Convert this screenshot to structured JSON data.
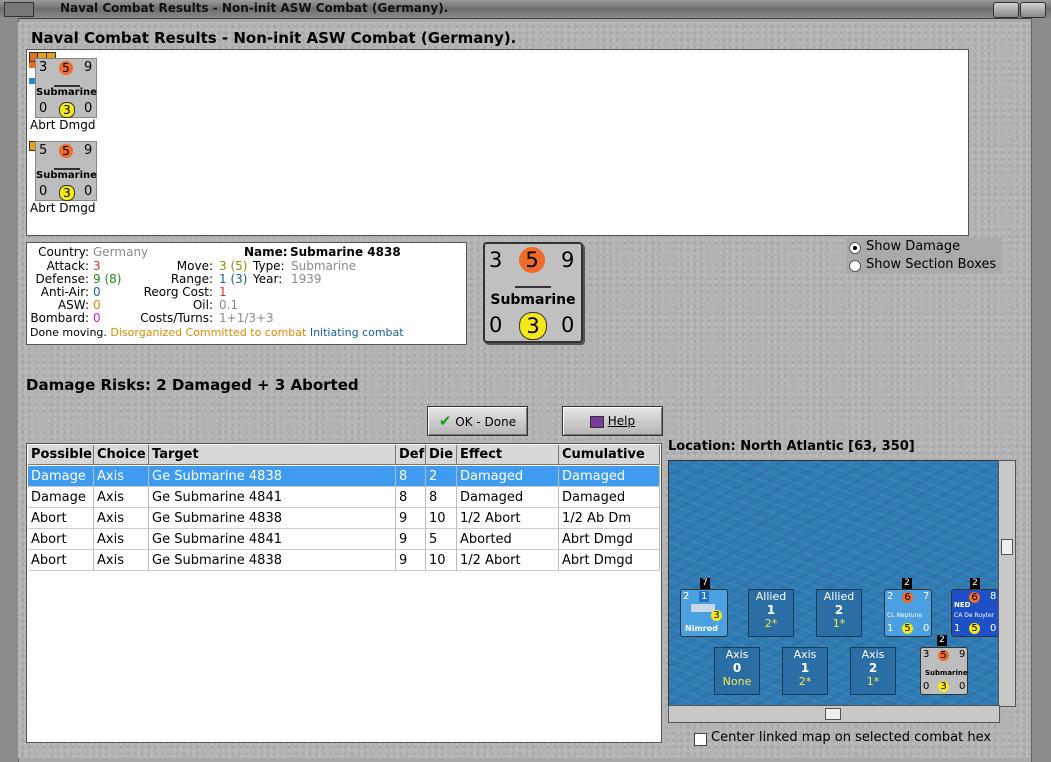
{
  "window": {
    "title": "Naval Combat Results - Non-init ASW Combat (Germany)."
  },
  "heading": "Naval Combat Results - Non-init ASW Combat (Germany).",
  "units": [
    {
      "top_left": "3",
      "top_mid": "5",
      "top_right": "9",
      "name": "Submarine",
      "bot_left": "0",
      "bot_mid": "3",
      "bot_right": "0",
      "caption": "Abrt Dmgd"
    },
    {
      "top_left": "5",
      "top_mid": "5",
      "top_right": "9",
      "name": "Submarine",
      "bot_left": "0",
      "bot_mid": "3",
      "bot_right": "0",
      "caption": "Abrt Dmgd"
    }
  ],
  "info": {
    "country_label": "Country:",
    "country": "Germany",
    "attack_label": "Attack:",
    "attack": "3",
    "defense_label": "Defense:",
    "defense": "9 (8)",
    "antiair_label": "Anti-Air:",
    "antiair": "0",
    "asw_label": "ASW:",
    "asw": "0",
    "bombard_label": "Bombard:",
    "bombard": "0",
    "move_label": "Move:",
    "move": "3 (5)",
    "range_label": "Range:",
    "range": "1 (3)",
    "reorg_label": "Reorg Cost:",
    "reorg": "1",
    "oil_label": "Oil:",
    "oil": "0.1",
    "costs_label": "Costs/Turns:",
    "costs": "1+1/3+3",
    "name_label": "Name:",
    "name": "Submarine 4838",
    "type_label": "Type:",
    "type": "Submarine",
    "year_label": "Year:",
    "year": "1939",
    "status_done": "Done moving.",
    "status_disorg": "Disorganized",
    "status_committed": "Committed to combat",
    "status_init": "Initiating combat"
  },
  "big_counter": {
    "top_left": "3",
    "top_mid": "5",
    "top_right": "9",
    "name": "Submarine",
    "bot_left": "0",
    "bot_mid": "3",
    "bot_right": "0"
  },
  "options": {
    "show_damage": "Show Damage",
    "show_sections": "Show Section Boxes"
  },
  "damage_risks": "Damage Risks:  2 Damaged + 3 Aborted",
  "buttons": {
    "ok": "OK - Done",
    "help": "Help"
  },
  "table": {
    "headers": [
      "Possible",
      "Choice",
      "Target",
      "Def",
      "Die",
      "Effect",
      "Cumulative"
    ],
    "rows": [
      [
        "Damage",
        "Axis",
        "Ge Submarine 4838",
        "8",
        "2",
        "Damaged",
        "Damaged"
      ],
      [
        "Damage",
        "Axis",
        "Ge Submarine 4841",
        "8",
        "8",
        "Damaged",
        "Damaged"
      ],
      [
        "Abort",
        "Axis",
        "Ge Submarine 4838",
        "9",
        "10",
        "1/2 Abort",
        "1/2 Ab Dm"
      ],
      [
        "Abort",
        "Axis",
        "Ge Submarine 4841",
        "9",
        "5",
        "Aborted",
        "Abrt Dmgd"
      ],
      [
        "Abort",
        "Axis",
        "Ge Submarine 4838",
        "9",
        "10",
        "1/2 Abort",
        "Abrt Dmgd"
      ]
    ]
  },
  "location": "Location:  North Atlantic [63, 350]",
  "map": {
    "allied_boxes": [
      {
        "label": "Allied",
        "value": "1",
        "sub": "2*"
      },
      {
        "label": "Allied",
        "value": "2",
        "sub": "1*"
      }
    ],
    "axis_boxes": [
      {
        "label": "Axis",
        "value": "0",
        "sub": "None"
      },
      {
        "label": "Axis",
        "value": "1",
        "sub": "2*"
      },
      {
        "label": "Axis",
        "value": "2",
        "sub": "1*"
      }
    ],
    "counters": {
      "nimrod": {
        "stack": "7",
        "name": "Nimrod",
        "tl": "2",
        "tm": "1",
        "bm": "3"
      },
      "neptune": {
        "stack": "2",
        "name": "CL Neptune",
        "tl": "2",
        "tm": "6",
        "tr": "7",
        "bl": "1",
        "bm": "5",
        "br": "0"
      },
      "deruyter": {
        "stack": "2",
        "nat": "NED",
        "name": "CA De Ruyter",
        "tm": "6",
        "tr": "8",
        "bl": "1",
        "bm": "5",
        "br": "0"
      },
      "sub": {
        "stack": "2",
        "name": "Submarine",
        "tl": "3",
        "tm": "5",
        "tr": "9",
        "bl": "0",
        "bm": "3",
        "br": "0"
      }
    }
  },
  "center_map": "Center linked map on selected combat hex",
  "colors": {
    "selected_row": "#3e9bf0",
    "attack_orange": "#f06a2a",
    "defense_yellow": "#f5e81a",
    "sea_blue": "#2f7bb4"
  }
}
